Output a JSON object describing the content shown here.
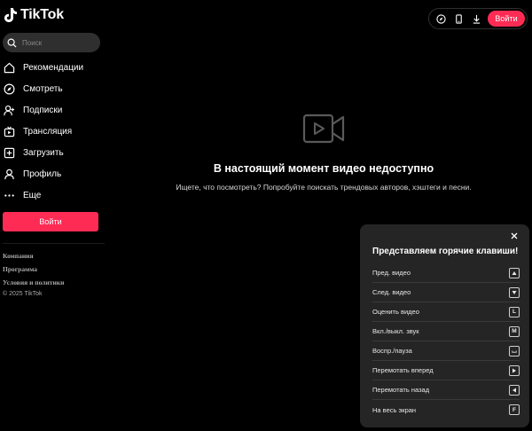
{
  "brand": {
    "name": "TikTok"
  },
  "header": {
    "icons": [
      "compass-icon",
      "phone-icon",
      "download-icon"
    ],
    "login_label": "Войти"
  },
  "search": {
    "placeholder": "Поиск"
  },
  "sidebar": {
    "items": [
      {
        "label": "Рекомендации",
        "icon": "home-icon"
      },
      {
        "label": "Смотреть",
        "icon": "compass-icon"
      },
      {
        "label": "Подписки",
        "icon": "user-plus-icon"
      },
      {
        "label": "Трансляция",
        "icon": "live-icon"
      },
      {
        "label": "Загрузить",
        "icon": "plus-square-icon"
      },
      {
        "label": "Профиль",
        "icon": "user-icon"
      },
      {
        "label": "Еще",
        "icon": "more-icon"
      }
    ],
    "login_label": "Войти"
  },
  "footer": {
    "links": [
      "Компания",
      "Программа",
      "Условия и политики"
    ],
    "copyright": "© 2025 TikTok"
  },
  "main": {
    "title": "В настоящий момент видео недоступно",
    "subtitle": "Ищете, что посмотреть? Попробуйте поискать трендовых авторов, хэштеги и песни."
  },
  "shortcuts_panel": {
    "title": "Представляем горячие клавиши!",
    "items": [
      {
        "label": "Пред. видео",
        "key": "arrow-up-icon"
      },
      {
        "label": "След. видео",
        "key": "arrow-down-icon"
      },
      {
        "label": "Оценить видео",
        "key": "L"
      },
      {
        "label": "Вкл./выкл. звук",
        "key": "M"
      },
      {
        "label": "Воспр./пауза",
        "key": "space-icon"
      },
      {
        "label": "Перемотать вперед",
        "key": "arrow-right-icon"
      },
      {
        "label": "Перемотать назад",
        "key": "arrow-left-icon"
      },
      {
        "label": "На весь экран",
        "key": "F"
      }
    ]
  },
  "colors": {
    "accent": "#fe2c55",
    "background": "#000000",
    "panel": "#252525"
  }
}
